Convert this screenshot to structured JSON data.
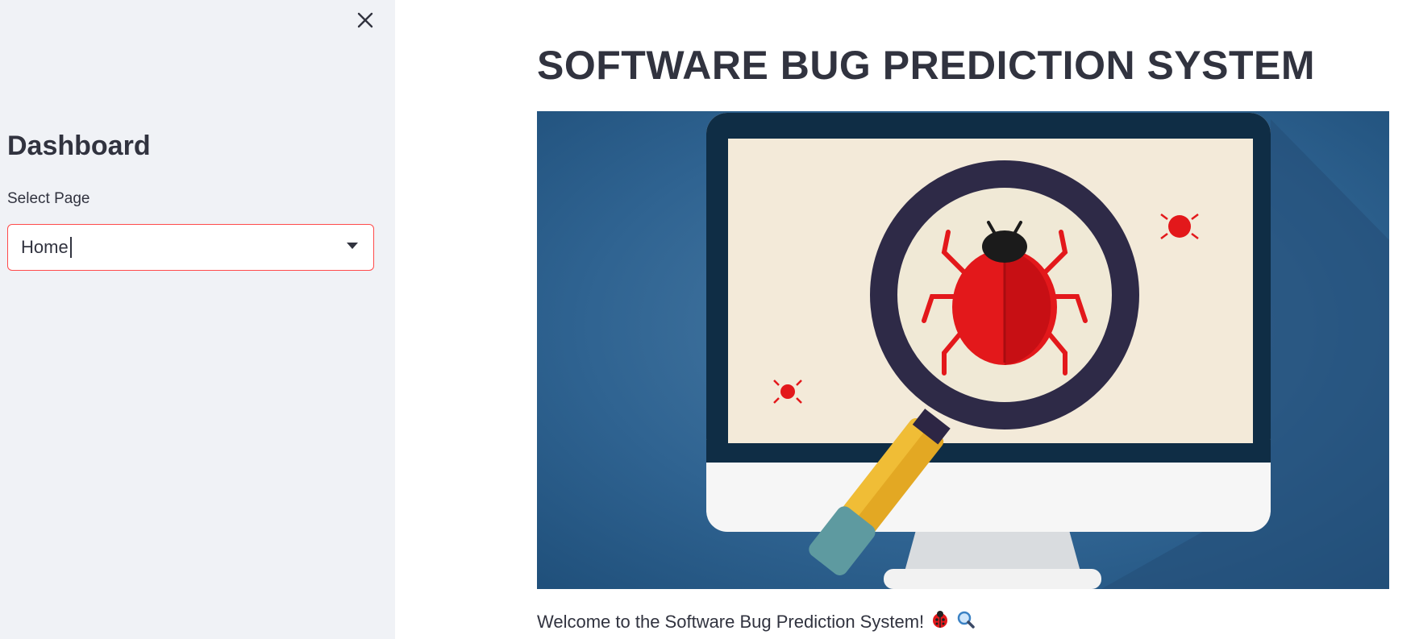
{
  "sidebar": {
    "title": "Dashboard",
    "select": {
      "label": "Select Page",
      "value": "Home"
    }
  },
  "main": {
    "title": "SOFTWARE BUG PREDICTION SYSTEM",
    "hero_image": "monitor with magnifying glass over ladybug illustration",
    "welcome_text": "Welcome to the Software Bug Prediction System!"
  },
  "icons": {
    "close": "close-icon",
    "dropdown": "chevron-down-icon",
    "welcome_emojis": [
      "ladybug-icon",
      "magnifier-icon"
    ]
  },
  "colors": {
    "sidebar_bg": "#f0f2f6",
    "accent": "#ff4b4b",
    "text": "#31333f",
    "hero_bg": "#2a5d8a"
  }
}
